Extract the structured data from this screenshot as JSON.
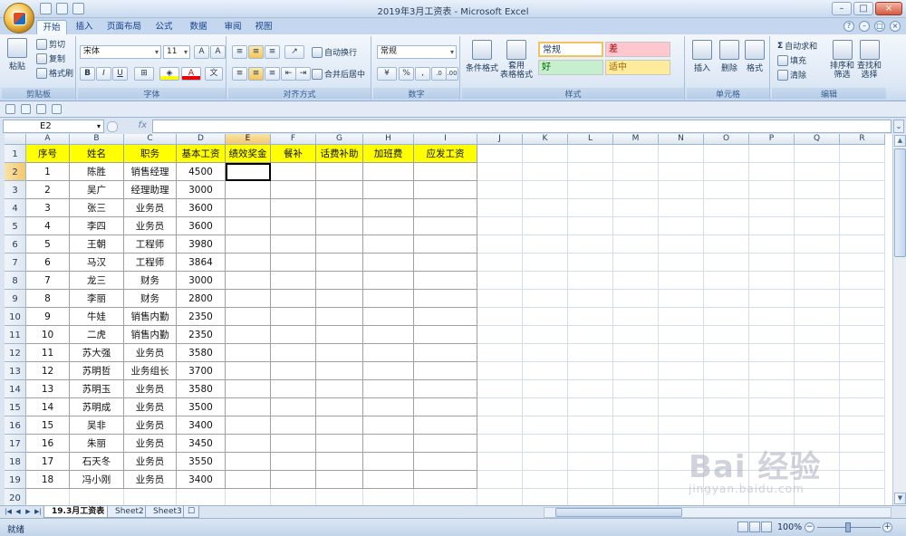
{
  "window": {
    "title": "2019年3月工资表 - Microsoft Excel"
  },
  "ribbon_tabs": [
    "开始",
    "插入",
    "页面布局",
    "公式",
    "数据",
    "审阅",
    "视图"
  ],
  "clipboard": {
    "paste": "粘贴",
    "cut": "剪切",
    "copy": "复制",
    "format_painter": "格式刷",
    "label": "剪贴板"
  },
  "font": {
    "name": "宋体",
    "size": "11",
    "bold": "B",
    "italic": "I",
    "underline": "U",
    "label": "字体"
  },
  "alignment": {
    "wrap": "自动换行",
    "merge": "合并后居中",
    "label": "对齐方式"
  },
  "number": {
    "format": "常规",
    "label": "数字"
  },
  "styles": {
    "cond_format": "条件格式",
    "table_format": "套用\n表格格式",
    "normal": "常规",
    "bad": "差",
    "good": "好",
    "neutral": "适中",
    "label": "样式"
  },
  "cells_group": {
    "insert": "插入",
    "delete": "删除",
    "format": "格式",
    "label": "单元格"
  },
  "editing": {
    "autosum": "自动求和",
    "fill": "填充",
    "clear": "清除",
    "sort": "排序和\n筛选",
    "find": "查找和\n选择",
    "label": "编辑"
  },
  "formula_bar": {
    "name_box": "E2",
    "fx": "fx"
  },
  "columns": [
    "A",
    "B",
    "C",
    "D",
    "E",
    "F",
    "G",
    "H",
    "I",
    "J",
    "K",
    "L",
    "M",
    "N",
    "O",
    "P",
    "Q",
    "R"
  ],
  "headers": [
    "序号",
    "姓名",
    "职务",
    "基本工资",
    "绩效奖金",
    "餐补",
    "话费补助",
    "加班费",
    "应发工资"
  ],
  "rows": [
    [
      "1",
      "陈胜",
      "销售经理",
      "4500"
    ],
    [
      "2",
      "吴广",
      "经理助理",
      "3000"
    ],
    [
      "3",
      "张三",
      "业务员",
      "3600"
    ],
    [
      "4",
      "李四",
      "业务员",
      "3600"
    ],
    [
      "5",
      "王朝",
      "工程师",
      "3980"
    ],
    [
      "6",
      "马汉",
      "工程师",
      "3864"
    ],
    [
      "7",
      "龙三",
      "财务",
      "3000"
    ],
    [
      "8",
      "李丽",
      "财务",
      "2800"
    ],
    [
      "9",
      "牛娃",
      "销售内勤",
      "2350"
    ],
    [
      "10",
      "二虎",
      "销售内勤",
      "2350"
    ],
    [
      "11",
      "苏大强",
      "业务员",
      "3580"
    ],
    [
      "12",
      "苏明哲",
      "业务组长",
      "3700"
    ],
    [
      "13",
      "苏明玉",
      "业务员",
      "3580"
    ],
    [
      "14",
      "苏明成",
      "业务员",
      "3500"
    ],
    [
      "15",
      "吴非",
      "业务员",
      "3400"
    ],
    [
      "16",
      "朱丽",
      "业务员",
      "3450"
    ],
    [
      "17",
      "石天冬",
      "业务员",
      "3550"
    ],
    [
      "18",
      "冯小刚",
      "业务员",
      "3400"
    ]
  ],
  "row_numbers": [
    "1",
    "2",
    "3",
    "4",
    "5",
    "6",
    "7",
    "8",
    "9",
    "10",
    "11",
    "12",
    "13",
    "14",
    "15",
    "16",
    "17",
    "18",
    "19",
    "20"
  ],
  "sheets": [
    "19.3月工资表",
    "Sheet2",
    "Sheet3"
  ],
  "status": {
    "ready": "就绪",
    "zoom": "100%"
  },
  "watermark": {
    "brand": "Bai 经验",
    "url": "jingyan.baidu.com"
  },
  "colors": {
    "header_fill": "#ffff00",
    "accent": "#15428b"
  }
}
